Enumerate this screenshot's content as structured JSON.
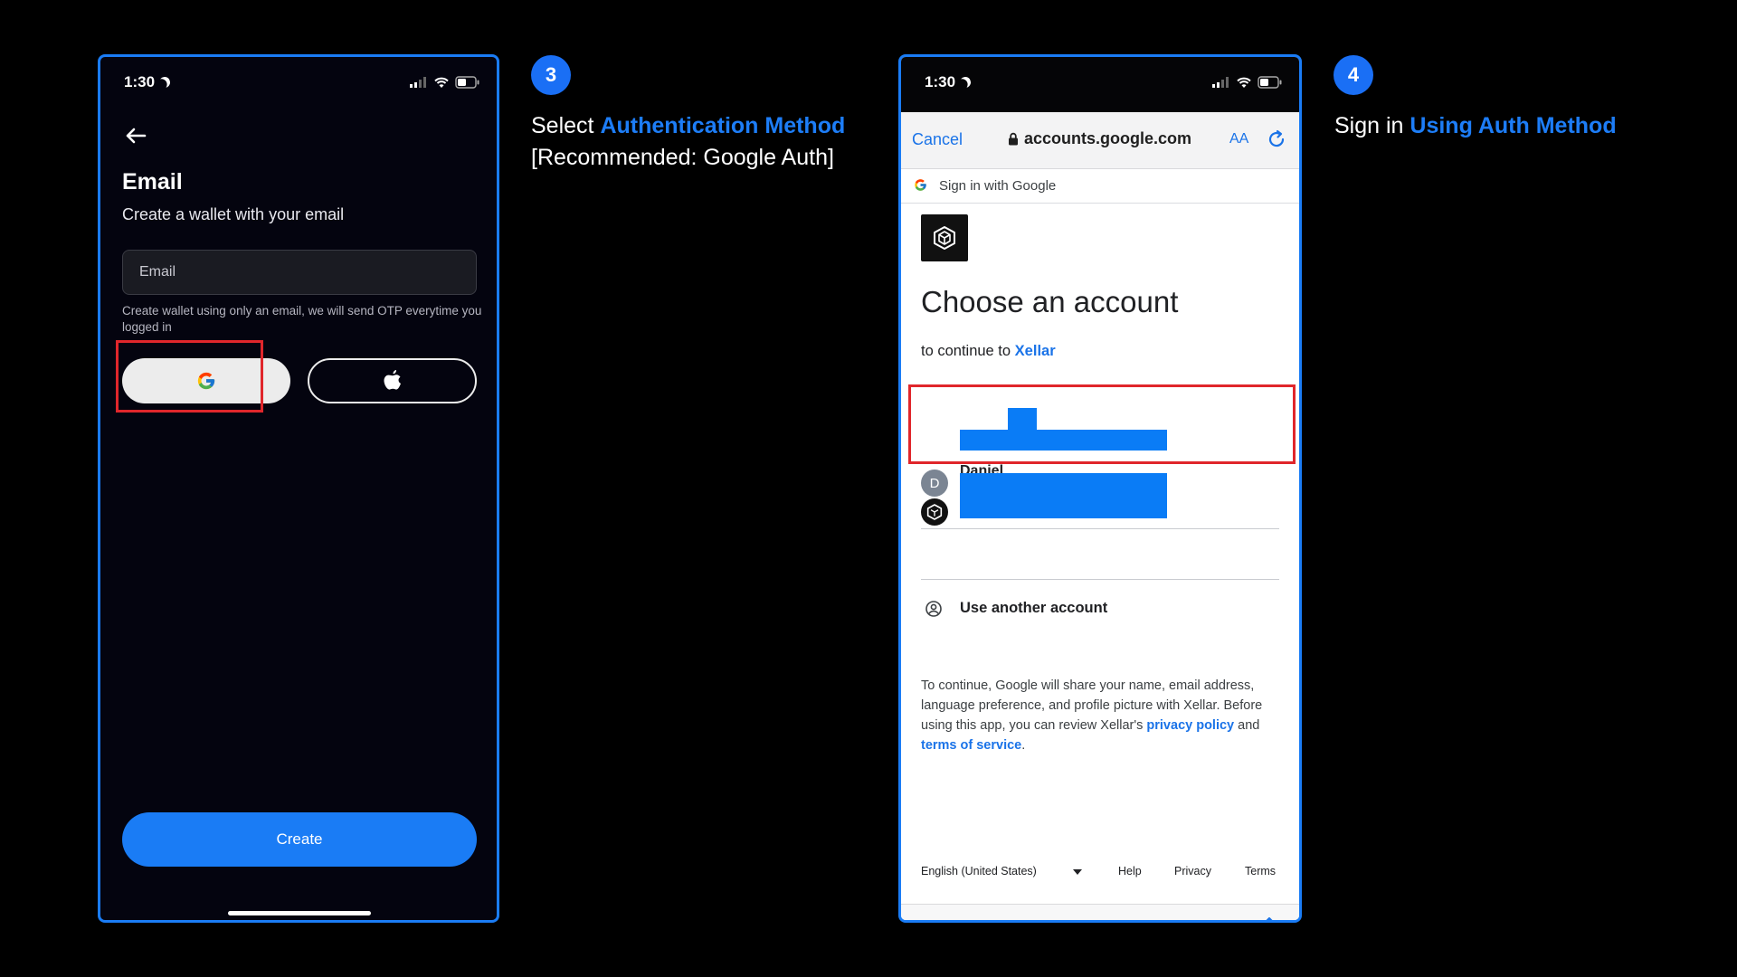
{
  "phone1": {
    "status_time": "1:30",
    "title": "Email",
    "subtitle": "Create a wallet with your email",
    "email_placeholder": "Email",
    "hint": "Create wallet using only an email, we will send OTP everytime you logged in",
    "create_label": "Create"
  },
  "step3": {
    "number": "3",
    "line1_prefix": "Select ",
    "line1_highlight": "Authentication Method",
    "line2": "[Recommended: Google Auth]"
  },
  "phone2": {
    "status_time": "1:30",
    "browser": {
      "cancel_label": "Cancel",
      "url": "accounts.google.com",
      "text_size_label": "AA"
    },
    "sign_in_banner": "Sign in with Google",
    "heading": "Choose an account",
    "continue_prefix": "to continue to ",
    "continue_app": "Xellar",
    "accounts": [
      {
        "initial": "D",
        "name": "Daniel"
      }
    ],
    "use_another": "Use another account",
    "disclaimer_text": "To continue, Google will share your name, email address, language preference, and profile picture with Xellar. Before using this app, you can review Xellar's ",
    "privacy_policy": "privacy policy",
    "and_text": " and ",
    "terms_of_service": "terms of service",
    "period": ".",
    "footer": {
      "language": "English (United States)",
      "help": "Help",
      "privacy": "Privacy",
      "terms": "Terms"
    }
  },
  "step4": {
    "number": "4",
    "prefix": "Sign in ",
    "highlight": "Using Auth Method"
  },
  "colors": {
    "accent_blue": "#1a7cf5",
    "highlight_red": "#e0262b",
    "google_link_blue": "#1a73e8",
    "redaction_blue": "#0a7cf6"
  }
}
